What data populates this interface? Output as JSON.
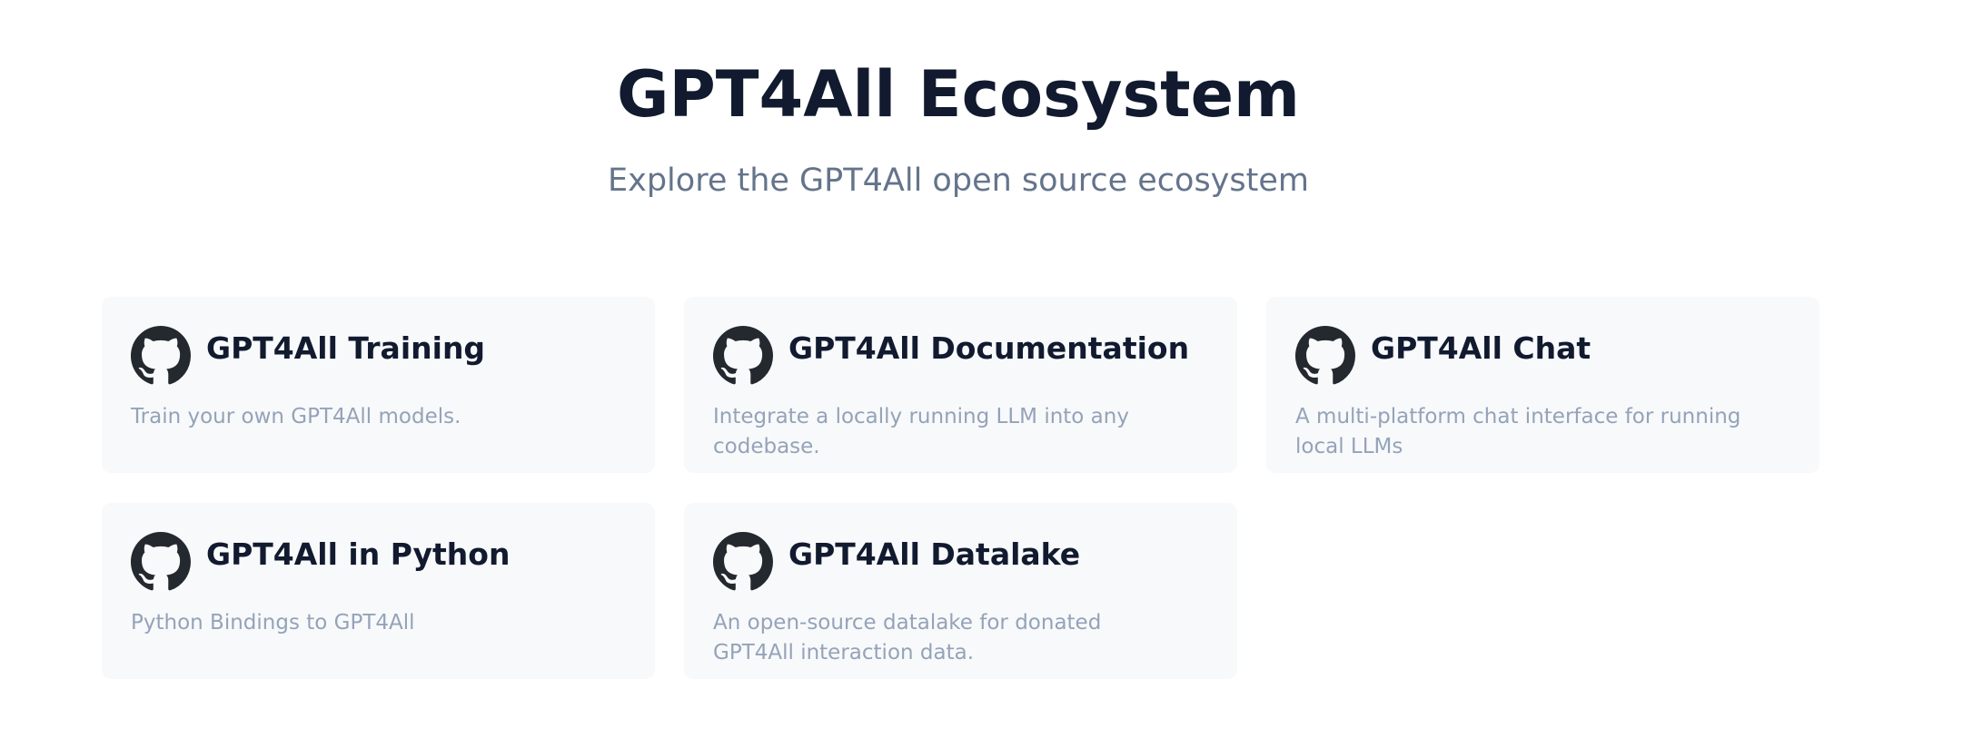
{
  "header": {
    "title": "GPT4All Ecosystem",
    "subtitle": "Explore the GPT4All open source ecosystem"
  },
  "cards": [
    {
      "title": "GPT4All Training",
      "description": "Train your own GPT4All models.",
      "icon": "github-icon"
    },
    {
      "title": "GPT4All Documentation",
      "description": "Integrate a locally running LLM into any codebase.",
      "icon": "github-icon"
    },
    {
      "title": "GPT4All Chat",
      "description": "A multi-platform chat interface for running local LLMs",
      "icon": "github-icon"
    },
    {
      "title": "GPT4All in Python",
      "description": "Python Bindings to GPT4All",
      "icon": "github-icon"
    },
    {
      "title": "GPT4All Datalake",
      "description": "An open-source datalake for donated GPT4All interaction data.",
      "icon": "github-icon"
    }
  ],
  "colors": {
    "title": "#111a2e",
    "subtitle": "#64748b",
    "card_background": "#f8f9fb",
    "card_description": "#94a3b8",
    "icon": "#24292f"
  }
}
